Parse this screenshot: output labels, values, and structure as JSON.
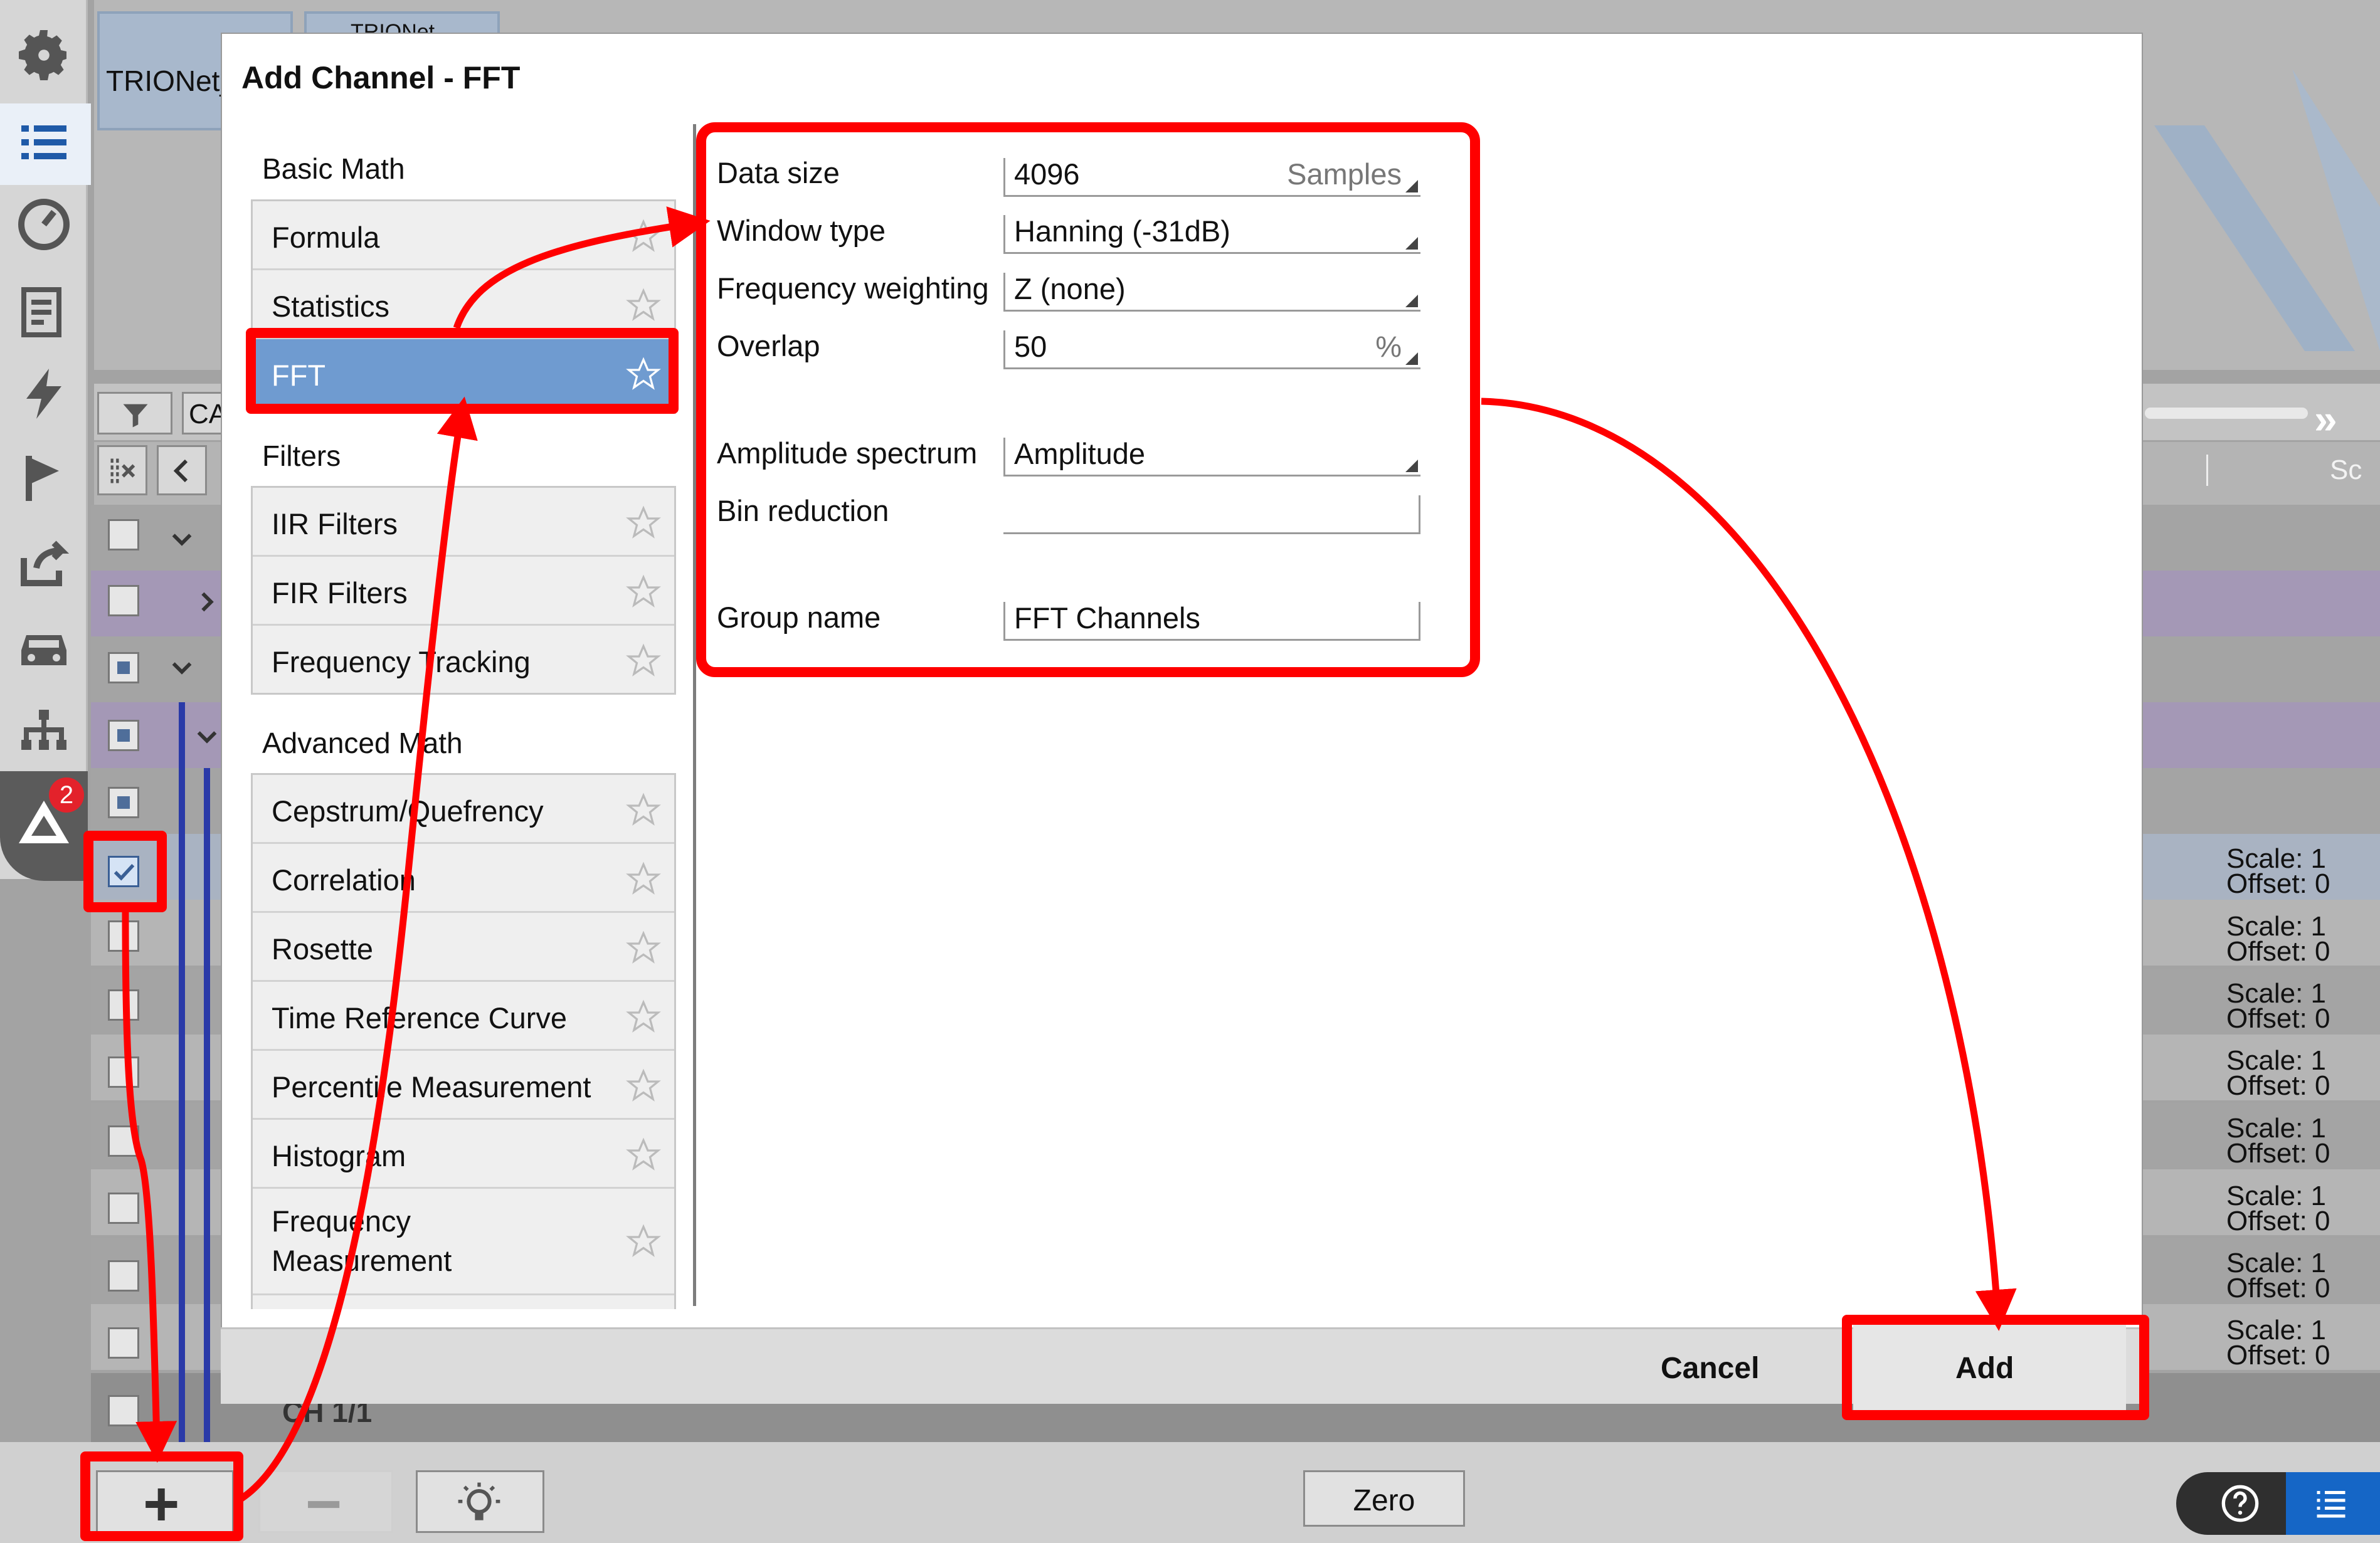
{
  "app": {
    "device_tab": "TRIONet_",
    "device_tab2": "TRIONet",
    "bg_header_col": "CA",
    "bg_right_header": "Sc",
    "rail_badge": "2",
    "rail_icons": [
      "gear-icon",
      "list-icon",
      "gauge-icon",
      "report-icon",
      "lightning-icon",
      "flag-icon",
      "export-icon",
      "car-icon",
      "network-icon",
      "dewesoft-logo-icon"
    ],
    "scale_rows": [
      {
        "scale": "Scale:  1",
        "offset": "Offset: 0"
      },
      {
        "scale": "Scale:  1",
        "offset": "Offset: 0"
      },
      {
        "scale": "Scale:  1",
        "offset": "Offset: 0"
      },
      {
        "scale": "Scale:  1",
        "offset": "Offset: 0"
      },
      {
        "scale": "Scale:  1",
        "offset": "Offset: 0"
      },
      {
        "scale": "Scale:  1",
        "offset": "Offset: 0"
      },
      {
        "scale": "Scale:  1",
        "offset": "Offset: 0"
      },
      {
        "scale": "Scale:  1",
        "offset": "Offset: 0"
      }
    ],
    "bg_row_label": "CH 1/1"
  },
  "dialog": {
    "title": "Add Channel - FFT",
    "sections": [
      {
        "heading": "Basic Math",
        "items": [
          "Formula",
          "Statistics",
          "FFT"
        ]
      },
      {
        "heading": "Filters",
        "items": [
          "IIR Filters",
          "FIR Filters",
          "Frequency Tracking"
        ]
      },
      {
        "heading": "Advanced Math",
        "items": [
          "Cepstrum/Quefrency",
          "Correlation",
          "Rosette",
          "Time Reference Curve",
          "Percentile Measurement",
          "Histogram",
          "Frequency Measurement"
        ]
      }
    ],
    "selected_item": "FFT",
    "properties": {
      "data_size": {
        "label": "Data size",
        "value": "4096",
        "unit": "Samples"
      },
      "window_type": {
        "label": "Window type",
        "value": "Hanning (-31dB)"
      },
      "freq_weighting": {
        "label": "Frequency weighting",
        "value": "Z (none)"
      },
      "overlap": {
        "label": "Overlap",
        "value": "50",
        "unit": "%"
      },
      "amplitude_spectrum": {
        "label": "Amplitude spectrum",
        "value": "Amplitude"
      },
      "bin_reduction": {
        "label": "Bin reduction",
        "value": ""
      },
      "group_name": {
        "label": "Group name",
        "value": "FFT Channels"
      }
    },
    "cancel_label": "Cancel",
    "add_label": "Add"
  },
  "bottom_bar": {
    "add_symbol": "+",
    "remove_symbol": "−",
    "zero_label": "Zero"
  },
  "colors": {
    "annotation": "#ff0000",
    "selection": "#6f9bd0"
  }
}
